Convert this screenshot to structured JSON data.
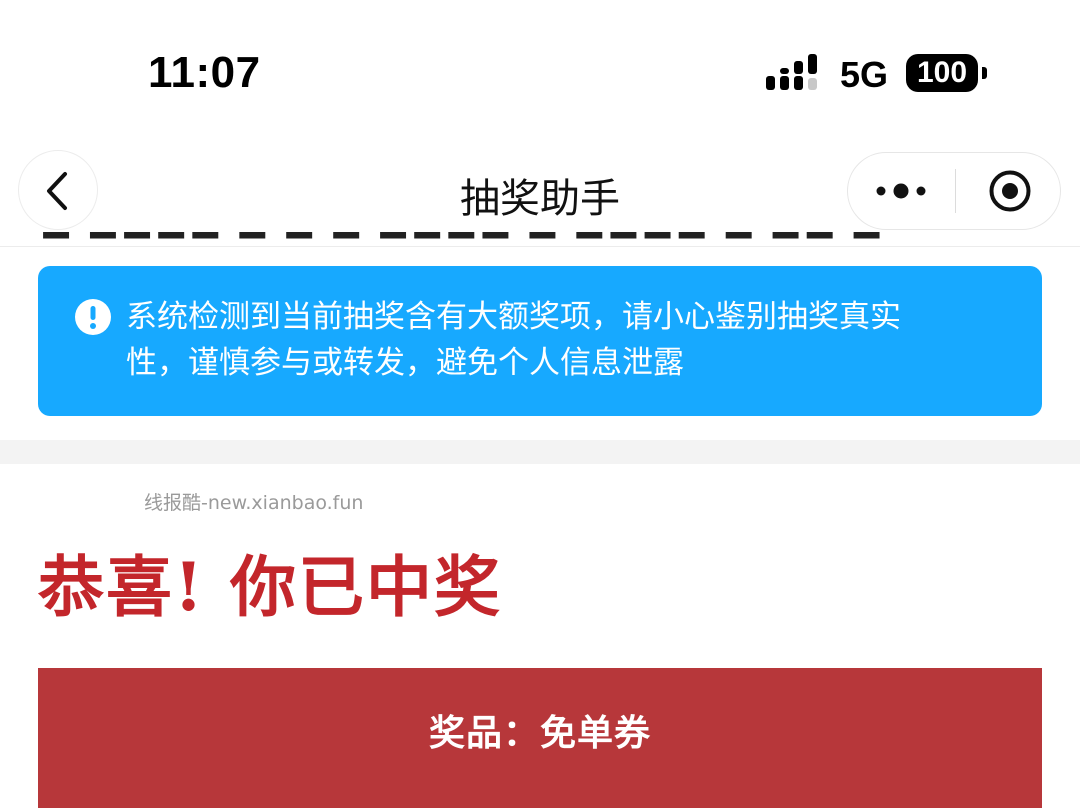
{
  "status_bar": {
    "time": "11:07",
    "network": "5G",
    "battery": "100"
  },
  "nav": {
    "title": "抽奖助手",
    "back_icon": "chevron-left-icon",
    "more_icon": "more-dots-icon",
    "close_icon": "target-circle-icon"
  },
  "notice": {
    "icon": "exclamation-circle-icon",
    "text": "系统检测到当前抽奖含有大额奖项，请小心鉴别抽奖真实性，谨慎参与或转发，避免个人信息泄露",
    "color": "#17a9ff"
  },
  "result": {
    "watermark": "线报酷-new.xianbao.fun",
    "headline": "恭喜! 你已中奖",
    "headline_color": "#c3262b",
    "prize_label": "奖品：免单券",
    "prize_card_color": "#b7373a"
  }
}
